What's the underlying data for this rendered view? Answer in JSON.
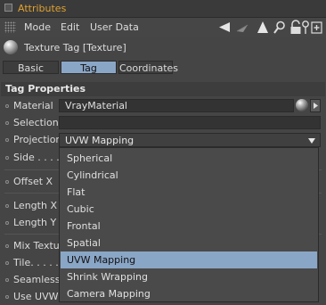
{
  "window": {
    "title": "Attributes"
  },
  "menubar": {
    "items": [
      "Mode",
      "Edit",
      "User Data"
    ]
  },
  "object": {
    "title": "Texture Tag [Texture]"
  },
  "tabs": [
    {
      "label": "Basic",
      "active": false
    },
    {
      "label": "Tag",
      "active": true
    },
    {
      "label": "Coordinates",
      "active": false
    }
  ],
  "section": {
    "title": "Tag Properties"
  },
  "properties": {
    "material": {
      "label": "Material",
      "value": "VrayMaterial"
    },
    "selection": {
      "label": "Selection",
      "value": ""
    },
    "projection": {
      "label": "Projection",
      "value": "UVW Mapping"
    },
    "side": {
      "label": "Side . . . ."
    },
    "offset_x": {
      "label": "Offset X"
    },
    "length_x": {
      "label": "Length X"
    },
    "length_y": {
      "label": "Length Y"
    },
    "mix_textures": {
      "label": "Mix Texture"
    },
    "tile": {
      "label": "Tile. . . . ."
    },
    "seamless": {
      "label": "Seamless ."
    },
    "use_uvw": {
      "label": "Use UVW"
    }
  },
  "projection_options": [
    "Spherical",
    "Cylindrical",
    "Flat",
    "Cubic",
    "Frontal",
    "Spatial",
    "UVW Mapping",
    "Shrink Wrapping",
    "Camera Mapping"
  ],
  "selected_projection": "UVW Mapping",
  "colors": {
    "title_text": "#e0a230",
    "active_tab": "#8aa6c6",
    "selected_option": "#8aa6c6",
    "panel_bg": "#454545"
  }
}
